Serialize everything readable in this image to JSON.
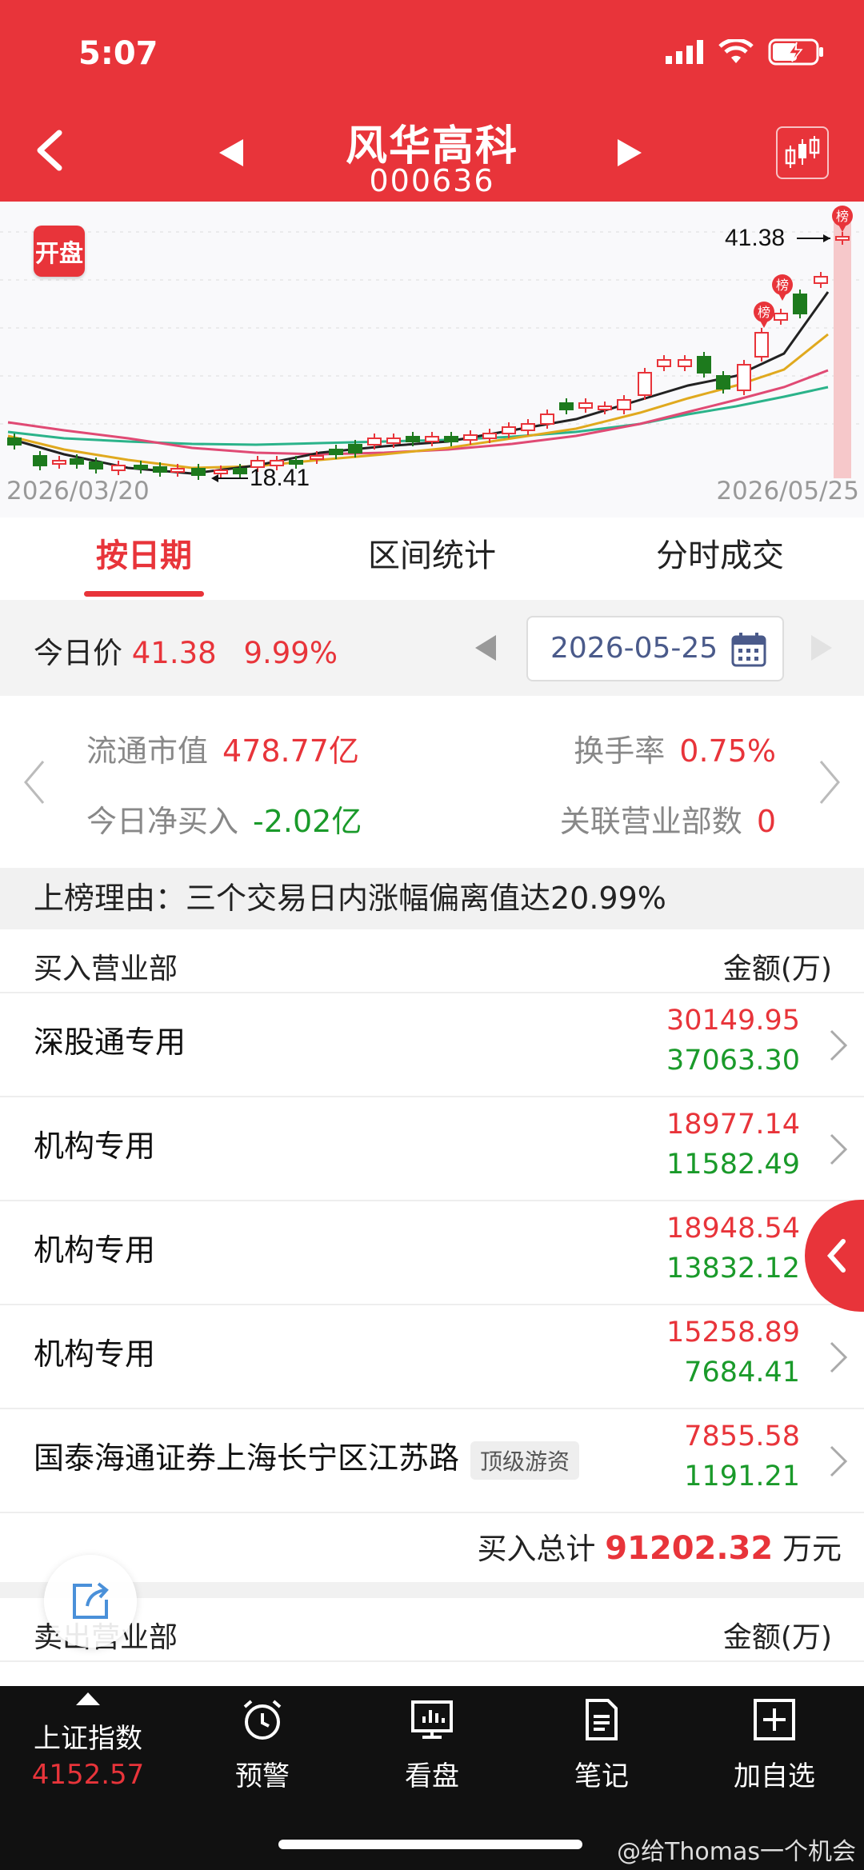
{
  "status": {
    "time": "5:07"
  },
  "header": {
    "title": "风华高科",
    "code": "000636"
  },
  "chart": {
    "badge": "开盘",
    "high_label": "41.38",
    "low_label": "18.41",
    "date_start": "2026/03/20",
    "date_end": "2026/05/25",
    "marker_label": "榜"
  },
  "tabs": [
    {
      "label": "按日期"
    },
    {
      "label": "区间统计"
    },
    {
      "label": "分时成交"
    }
  ],
  "today": {
    "label": "今日价",
    "price": "41.38",
    "change": "9.99%",
    "date": "2026-05-25"
  },
  "stats": {
    "float_cap_label": "流通市值",
    "float_cap": "478.77亿",
    "turnover_label": "换手率",
    "turnover": "0.75%",
    "net_buy_label": "今日净买入",
    "net_buy": "-2.02亿",
    "related_label": "关联营业部数",
    "related": "0"
  },
  "reason": "上榜理由：三个交易日内涨幅偏离值达20.99%",
  "buy_section": {
    "title": "买入营业部",
    "amount_label": "金额(万)",
    "rows": [
      {
        "name": "深股通专用",
        "buy": "30149.95",
        "sell": "37063.30",
        "tag": ""
      },
      {
        "name": "机构专用",
        "buy": "18977.14",
        "sell": "11582.49",
        "tag": ""
      },
      {
        "name": "机构专用",
        "buy": "18948.54",
        "sell": "13832.12",
        "tag": ""
      },
      {
        "name": "机构专用",
        "buy": "15258.89",
        "sell": "7684.41",
        "tag": ""
      },
      {
        "name": "国泰海通证券上海长宁区江苏路",
        "buy": "7855.58",
        "sell": "1191.21",
        "tag": "顶级游资"
      }
    ],
    "total_label": "买入总计",
    "total_value": "91202.32",
    "total_unit": "万元"
  },
  "sell_section": {
    "title": "卖出营业部",
    "amount_label": "金额(万)"
  },
  "bottom_nav": {
    "index_name": "上证指数",
    "index_value": "4152.57",
    "items": [
      {
        "label": "预警"
      },
      {
        "label": "看盘"
      },
      {
        "label": "笔记"
      },
      {
        "label": "加自选"
      }
    ]
  },
  "watermark": "@给Thomas一个机会",
  "colors": {
    "brand_red": "#e8343a",
    "down_green": "#1a9a2a"
  }
}
